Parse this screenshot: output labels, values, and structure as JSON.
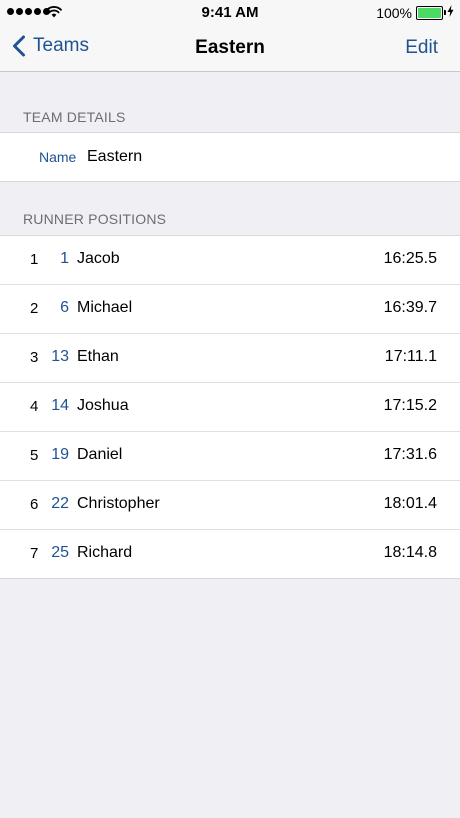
{
  "status_bar": {
    "time": "9:41 AM",
    "battery_percent": "100%",
    "battery_level": 1.0,
    "signal_bars": 5
  },
  "nav": {
    "back_label": "Teams",
    "title": "Eastern",
    "edit_label": "Edit"
  },
  "team_details": {
    "header": "TEAM DETAILS",
    "name_label": "Name",
    "name_value": "Eastern"
  },
  "runner_positions": {
    "header": "RUNNER POSITIONS",
    "rows": [
      {
        "position": "1",
        "bib": "1",
        "name": "Jacob",
        "time": "16:25.5"
      },
      {
        "position": "2",
        "bib": "6",
        "name": "Michael",
        "time": "16:39.7"
      },
      {
        "position": "3",
        "bib": "13",
        "name": "Ethan",
        "time": "17:11.1"
      },
      {
        "position": "4",
        "bib": "14",
        "name": "Joshua",
        "time": "17:15.2"
      },
      {
        "position": "5",
        "bib": "19",
        "name": "Daniel",
        "time": "17:31.6"
      },
      {
        "position": "6",
        "bib": "22",
        "name": "Christopher",
        "time": "18:01.4"
      },
      {
        "position": "7",
        "bib": "25",
        "name": "Richard",
        "time": "18:14.8"
      }
    ]
  },
  "colors": {
    "accent": "#1e5392",
    "background": "#efeff4",
    "battery": "#4cd964"
  },
  "icons": {
    "back": "chevron-left-icon",
    "wifi": "wifi-icon",
    "battery": "battery-icon",
    "charging": "bolt-icon",
    "signal": "signal-dots-icon"
  }
}
